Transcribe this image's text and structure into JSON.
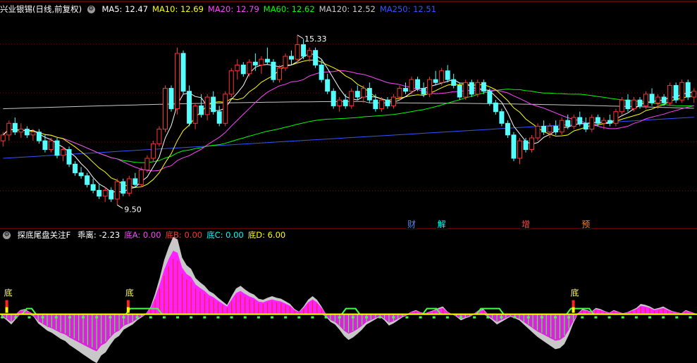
{
  "top_header": {
    "stock_name": "兴业银锡(日线,前复权)",
    "ma": [
      {
        "label": "MA5: 12.47",
        "color": "#ffffff"
      },
      {
        "label": "MA10: 12.69",
        "color": "#ffff00"
      },
      {
        "label": "MA20: 12.79",
        "color": "#ff44ff"
      },
      {
        "label": "MA60: 12.62",
        "color": "#00ff00"
      },
      {
        "label": "MA120: 12.52",
        "color": "#c8c8c8"
      },
      {
        "label": "MA250: 12.51",
        "color": "#3355ff"
      }
    ]
  },
  "bottom_header": {
    "indicator_name": "探底尾盘关注F",
    "values": [
      {
        "label": "乖离: -2.23",
        "color": "#ffffff"
      },
      {
        "label": "底A: 0.00",
        "color": "#ff44ff"
      },
      {
        "label": "底B: 0.00",
        "color": "#ff3333"
      },
      {
        "label": "底C: 0.00",
        "color": "#00ffff"
      },
      {
        "label": "底D: 6.00",
        "color": "#ffff00"
      }
    ]
  },
  "colors": {
    "up": "#ff3333",
    "down": "#54ffff",
    "grid": "#8a0000",
    "divider": "#b00000"
  },
  "chart_data": [
    {
      "type": "candlestick",
      "high_label": "15.33",
      "low_label": "9.50",
      "yrange": [
        9.0,
        16.0
      ],
      "candles": [
        {
          "o": 11.7,
          "h": 12.0,
          "l": 11.5,
          "c": 11.9
        },
        {
          "o": 11.9,
          "h": 12.4,
          "l": 11.7,
          "c": 12.3
        },
        {
          "o": 12.3,
          "h": 12.5,
          "l": 11.9,
          "c": 12.0
        },
        {
          "o": 12.0,
          "h": 12.3,
          "l": 11.8,
          "c": 12.1
        },
        {
          "o": 12.1,
          "h": 12.2,
          "l": 11.8,
          "c": 11.9
        },
        {
          "o": 11.9,
          "h": 12.1,
          "l": 11.7,
          "c": 12.0
        },
        {
          "o": 12.0,
          "h": 12.1,
          "l": 11.6,
          "c": 11.7
        },
        {
          "o": 11.7,
          "h": 11.9,
          "l": 11.3,
          "c": 11.4
        },
        {
          "o": 11.4,
          "h": 11.8,
          "l": 11.3,
          "c": 11.7
        },
        {
          "o": 11.7,
          "h": 11.8,
          "l": 11.1,
          "c": 11.2
        },
        {
          "o": 11.2,
          "h": 11.5,
          "l": 11.0,
          "c": 11.4
        },
        {
          "o": 11.4,
          "h": 11.5,
          "l": 10.8,
          "c": 10.9
        },
        {
          "o": 10.9,
          "h": 11.0,
          "l": 10.5,
          "c": 10.6
        },
        {
          "o": 10.6,
          "h": 10.8,
          "l": 10.4,
          "c": 10.5
        },
        {
          "o": 10.5,
          "h": 10.6,
          "l": 10.1,
          "c": 10.2
        },
        {
          "o": 10.2,
          "h": 10.4,
          "l": 9.9,
          "c": 10.0
        },
        {
          "o": 10.0,
          "h": 10.2,
          "l": 9.7,
          "c": 9.8
        },
        {
          "o": 9.8,
          "h": 10.1,
          "l": 9.6,
          "c": 10.0
        },
        {
          "o": 10.0,
          "h": 10.1,
          "l": 9.6,
          "c": 9.7
        },
        {
          "o": 9.7,
          "h": 10.4,
          "l": 9.5,
          "c": 10.3
        },
        {
          "o": 10.3,
          "h": 10.4,
          "l": 9.8,
          "c": 9.9
        },
        {
          "o": 9.9,
          "h": 10.5,
          "l": 9.8,
          "c": 10.4
        },
        {
          "o": 10.4,
          "h": 10.6,
          "l": 10.1,
          "c": 10.2
        },
        {
          "o": 10.2,
          "h": 10.8,
          "l": 10.1,
          "c": 10.7
        },
        {
          "o": 10.7,
          "h": 11.2,
          "l": 10.6,
          "c": 11.1
        },
        {
          "o": 11.1,
          "h": 11.7,
          "l": 11.0,
          "c": 11.6
        },
        {
          "o": 11.6,
          "h": 12.2,
          "l": 11.5,
          "c": 12.1
        },
        {
          "o": 12.1,
          "h": 13.6,
          "l": 12.0,
          "c": 13.5
        },
        {
          "o": 13.5,
          "h": 13.6,
          "l": 12.7,
          "c": 12.8
        },
        {
          "o": 12.8,
          "h": 14.9,
          "l": 12.6,
          "c": 14.7
        },
        {
          "o": 14.7,
          "h": 14.8,
          "l": 13.3,
          "c": 13.4
        },
        {
          "o": 13.4,
          "h": 13.6,
          "l": 12.2,
          "c": 12.3
        },
        {
          "o": 12.3,
          "h": 13.0,
          "l": 12.1,
          "c": 12.9
        },
        {
          "o": 12.9,
          "h": 13.3,
          "l": 12.5,
          "c": 12.6
        },
        {
          "o": 12.6,
          "h": 13.3,
          "l": 12.4,
          "c": 13.2
        },
        {
          "o": 13.2,
          "h": 13.4,
          "l": 12.6,
          "c": 12.7
        },
        {
          "o": 12.7,
          "h": 12.9,
          "l": 12.2,
          "c": 12.3
        },
        {
          "o": 12.3,
          "h": 13.4,
          "l": 12.2,
          "c": 13.3
        },
        {
          "o": 13.3,
          "h": 14.2,
          "l": 13.2,
          "c": 14.1
        },
        {
          "o": 14.1,
          "h": 14.5,
          "l": 13.8,
          "c": 14.3
        },
        {
          "o": 14.3,
          "h": 14.4,
          "l": 13.9,
          "c": 14.0
        },
        {
          "o": 14.0,
          "h": 14.5,
          "l": 13.9,
          "c": 14.4
        },
        {
          "o": 14.4,
          "h": 14.7,
          "l": 14.1,
          "c": 14.3
        },
        {
          "o": 14.3,
          "h": 14.6,
          "l": 14.0,
          "c": 14.5
        },
        {
          "o": 14.5,
          "h": 14.9,
          "l": 14.3,
          "c": 14.4
        },
        {
          "o": 14.4,
          "h": 14.5,
          "l": 13.7,
          "c": 13.8
        },
        {
          "o": 13.8,
          "h": 14.3,
          "l": 13.7,
          "c": 14.2
        },
        {
          "o": 14.2,
          "h": 14.7,
          "l": 14.1,
          "c": 14.6
        },
        {
          "o": 14.6,
          "h": 14.8,
          "l": 14.3,
          "c": 14.5
        },
        {
          "o": 14.5,
          "h": 15.33,
          "l": 14.4,
          "c": 15.0
        },
        {
          "o": 15.0,
          "h": 15.2,
          "l": 14.5,
          "c": 14.6
        },
        {
          "o": 14.6,
          "h": 14.9,
          "l": 14.4,
          "c": 14.8
        },
        {
          "o": 14.8,
          "h": 14.9,
          "l": 14.2,
          "c": 14.3
        },
        {
          "o": 14.3,
          "h": 14.5,
          "l": 13.7,
          "c": 13.8
        },
        {
          "o": 13.8,
          "h": 14.0,
          "l": 13.3,
          "c": 13.4
        },
        {
          "o": 13.4,
          "h": 13.5,
          "l": 12.8,
          "c": 12.9
        },
        {
          "o": 12.9,
          "h": 13.2,
          "l": 12.7,
          "c": 13.1
        },
        {
          "o": 13.1,
          "h": 13.3,
          "l": 12.8,
          "c": 12.9
        },
        {
          "o": 12.9,
          "h": 13.5,
          "l": 12.8,
          "c": 13.4
        },
        {
          "o": 13.4,
          "h": 13.6,
          "l": 13.1,
          "c": 13.2
        },
        {
          "o": 13.2,
          "h": 13.6,
          "l": 13.0,
          "c": 13.5
        },
        {
          "o": 13.5,
          "h": 13.7,
          "l": 13.0,
          "c": 13.1
        },
        {
          "o": 13.1,
          "h": 13.3,
          "l": 12.7,
          "c": 12.8
        },
        {
          "o": 12.8,
          "h": 13.2,
          "l": 12.7,
          "c": 13.1
        },
        {
          "o": 13.1,
          "h": 13.2,
          "l": 12.8,
          "c": 12.9
        },
        {
          "o": 12.9,
          "h": 13.3,
          "l": 12.8,
          "c": 13.2
        },
        {
          "o": 13.2,
          "h": 13.6,
          "l": 13.1,
          "c": 13.5
        },
        {
          "o": 13.5,
          "h": 13.7,
          "l": 13.3,
          "c": 13.4
        },
        {
          "o": 13.4,
          "h": 13.9,
          "l": 13.3,
          "c": 13.8
        },
        {
          "o": 13.8,
          "h": 13.9,
          "l": 13.4,
          "c": 13.5
        },
        {
          "o": 13.5,
          "h": 13.7,
          "l": 13.2,
          "c": 13.3
        },
        {
          "o": 13.3,
          "h": 13.9,
          "l": 13.2,
          "c": 13.8
        },
        {
          "o": 13.8,
          "h": 14.1,
          "l": 13.6,
          "c": 13.7
        },
        {
          "o": 13.7,
          "h": 14.2,
          "l": 13.6,
          "c": 14.1
        },
        {
          "o": 14.1,
          "h": 14.3,
          "l": 13.7,
          "c": 13.8
        },
        {
          "o": 13.8,
          "h": 14.0,
          "l": 13.5,
          "c": 13.6
        },
        {
          "o": 13.6,
          "h": 13.7,
          "l": 13.1,
          "c": 13.2
        },
        {
          "o": 13.2,
          "h": 13.8,
          "l": 13.1,
          "c": 13.7
        },
        {
          "o": 13.7,
          "h": 13.8,
          "l": 13.2,
          "c": 13.3
        },
        {
          "o": 13.3,
          "h": 13.8,
          "l": 13.2,
          "c": 13.7
        },
        {
          "o": 13.7,
          "h": 13.8,
          "l": 13.3,
          "c": 13.4
        },
        {
          "o": 13.4,
          "h": 13.5,
          "l": 12.9,
          "c": 13.0
        },
        {
          "o": 13.0,
          "h": 13.1,
          "l": 12.6,
          "c": 12.7
        },
        {
          "o": 12.7,
          "h": 12.8,
          "l": 12.2,
          "c": 12.3
        },
        {
          "o": 12.3,
          "h": 12.4,
          "l": 11.8,
          "c": 11.9
        },
        {
          "o": 11.9,
          "h": 12.0,
          "l": 11.0,
          "c": 11.1
        },
        {
          "o": 11.1,
          "h": 11.8,
          "l": 10.9,
          "c": 11.7
        },
        {
          "o": 11.7,
          "h": 11.8,
          "l": 11.3,
          "c": 11.4
        },
        {
          "o": 11.4,
          "h": 11.9,
          "l": 11.3,
          "c": 11.8
        },
        {
          "o": 11.8,
          "h": 12.3,
          "l": 11.7,
          "c": 12.2
        },
        {
          "o": 12.2,
          "h": 12.4,
          "l": 11.9,
          "c": 12.0
        },
        {
          "o": 12.0,
          "h": 12.3,
          "l": 11.8,
          "c": 12.2
        },
        {
          "o": 12.2,
          "h": 12.4,
          "l": 11.9,
          "c": 12.0
        },
        {
          "o": 12.0,
          "h": 12.5,
          "l": 11.9,
          "c": 12.4
        },
        {
          "o": 12.4,
          "h": 12.6,
          "l": 12.1,
          "c": 12.2
        },
        {
          "o": 12.2,
          "h": 12.6,
          "l": 12.1,
          "c": 12.5
        },
        {
          "o": 12.5,
          "h": 12.7,
          "l": 12.2,
          "c": 12.3
        },
        {
          "o": 12.3,
          "h": 12.5,
          "l": 12.0,
          "c": 12.1
        },
        {
          "o": 12.1,
          "h": 12.6,
          "l": 12.0,
          "c": 12.5
        },
        {
          "o": 12.5,
          "h": 12.6,
          "l": 12.2,
          "c": 12.3
        },
        {
          "o": 12.3,
          "h": 12.5,
          "l": 12.1,
          "c": 12.4
        },
        {
          "o": 12.4,
          "h": 12.6,
          "l": 12.2,
          "c": 12.3
        },
        {
          "o": 12.3,
          "h": 12.8,
          "l": 12.2,
          "c": 12.7
        },
        {
          "o": 12.7,
          "h": 13.2,
          "l": 12.6,
          "c": 13.1
        },
        {
          "o": 13.1,
          "h": 13.3,
          "l": 12.7,
          "c": 12.8
        },
        {
          "o": 12.8,
          "h": 13.2,
          "l": 12.7,
          "c": 13.1
        },
        {
          "o": 13.1,
          "h": 13.2,
          "l": 12.8,
          "c": 12.9
        },
        {
          "o": 12.9,
          "h": 13.4,
          "l": 12.8,
          "c": 13.3
        },
        {
          "o": 13.3,
          "h": 13.5,
          "l": 12.9,
          "c": 13.0
        },
        {
          "o": 13.0,
          "h": 13.3,
          "l": 12.8,
          "c": 13.2
        },
        {
          "o": 13.2,
          "h": 13.3,
          "l": 12.9,
          "c": 13.0
        },
        {
          "o": 13.0,
          "h": 13.7,
          "l": 12.9,
          "c": 13.6
        },
        {
          "o": 13.6,
          "h": 13.7,
          "l": 13.0,
          "c": 13.1
        },
        {
          "o": 13.1,
          "h": 13.8,
          "l": 13.0,
          "c": 13.7
        },
        {
          "o": 13.7,
          "h": 13.8,
          "l": 13.1,
          "c": 13.2
        },
        {
          "o": 13.2,
          "h": 13.5,
          "l": 13.0,
          "c": 13.4
        }
      ],
      "events": [
        {
          "index": 68,
          "label": "财",
          "color": "#4488ff"
        },
        {
          "index": 73,
          "label": "解",
          "color": "#00ffff"
        },
        {
          "index": 87,
          "label": "增",
          "color": "#ff4444"
        },
        {
          "index": 97,
          "label": "预",
          "color": "#ff8800"
        }
      ]
    },
    {
      "type": "histogram",
      "yrange": [
        -1.0,
        1.6
      ],
      "signal_label": "底",
      "signal_indices": [
        1,
        28,
        127
      ],
      "values": [
        -0.05,
        -0.12,
        -0.2,
        -0.1,
        0.08,
        0.1,
        0.05,
        -0.05,
        -0.18,
        -0.25,
        -0.32,
        -0.36,
        -0.42,
        -0.48,
        -0.52,
        -0.6,
        -0.66,
        -0.72,
        -0.78,
        -0.84,
        -0.9,
        -0.95,
        -0.8,
        -0.74,
        -0.6,
        -0.48,
        -0.42,
        -0.3,
        -0.25,
        -0.2,
        -0.12,
        -0.06,
        0.02,
        0.15,
        0.4,
        0.7,
        1.05,
        1.3,
        1.5,
        1.45,
        1.1,
        0.95,
        0.88,
        0.7,
        0.62,
        0.55,
        0.45,
        0.4,
        0.32,
        0.25,
        0.18,
        0.35,
        0.5,
        0.55,
        0.48,
        0.42,
        0.38,
        0.3,
        0.28,
        0.32,
        0.35,
        0.32,
        0.3,
        0.25,
        0.2,
        0.1,
        0.05,
        0.15,
        0.28,
        0.35,
        0.28,
        0.15,
        -0.05,
        -0.15,
        -0.2,
        -0.3,
        -0.42,
        -0.5,
        -0.45,
        -0.38,
        -0.3,
        -0.2,
        -0.15,
        -0.1,
        -0.05,
        -0.12,
        -0.22,
        -0.18,
        -0.12,
        -0.06,
        -0.02,
        0.05,
        0.08,
        0.04,
        0.02,
        0.05,
        0.08,
        0.12,
        0.15,
        0.05,
        0.0,
        -0.05,
        -0.12,
        -0.08,
        -0.05,
        0.02,
        0.08,
        0.1,
        -0.05,
        -0.12,
        -0.2,
        -0.15,
        -0.1,
        -0.05,
        -0.08,
        -0.12,
        -0.2,
        -0.28,
        -0.36,
        -0.44,
        -0.5,
        -0.56,
        -0.62,
        -0.68,
        -0.66,
        -0.58,
        -0.4,
        -0.18,
        0.02,
        0.1,
        0.08,
        0.05,
        0.12,
        0.1,
        0.06,
        0.03,
        0.08,
        0.05,
        0.02,
        0.04,
        0.08,
        0.12,
        0.2,
        0.18,
        0.15,
        0.1,
        0.12,
        0.15,
        0.1,
        0.06,
        0.04,
        0.02,
        0.08,
        0.05,
        0.02
      ],
      "yellow_line": 0.0,
      "green_hump_ranges": [
        [
          5,
          8
        ],
        [
          28,
          36
        ],
        [
          76,
          80
        ],
        [
          94,
          98
        ],
        [
          106,
          112
        ],
        [
          126,
          132
        ]
      ]
    }
  ]
}
